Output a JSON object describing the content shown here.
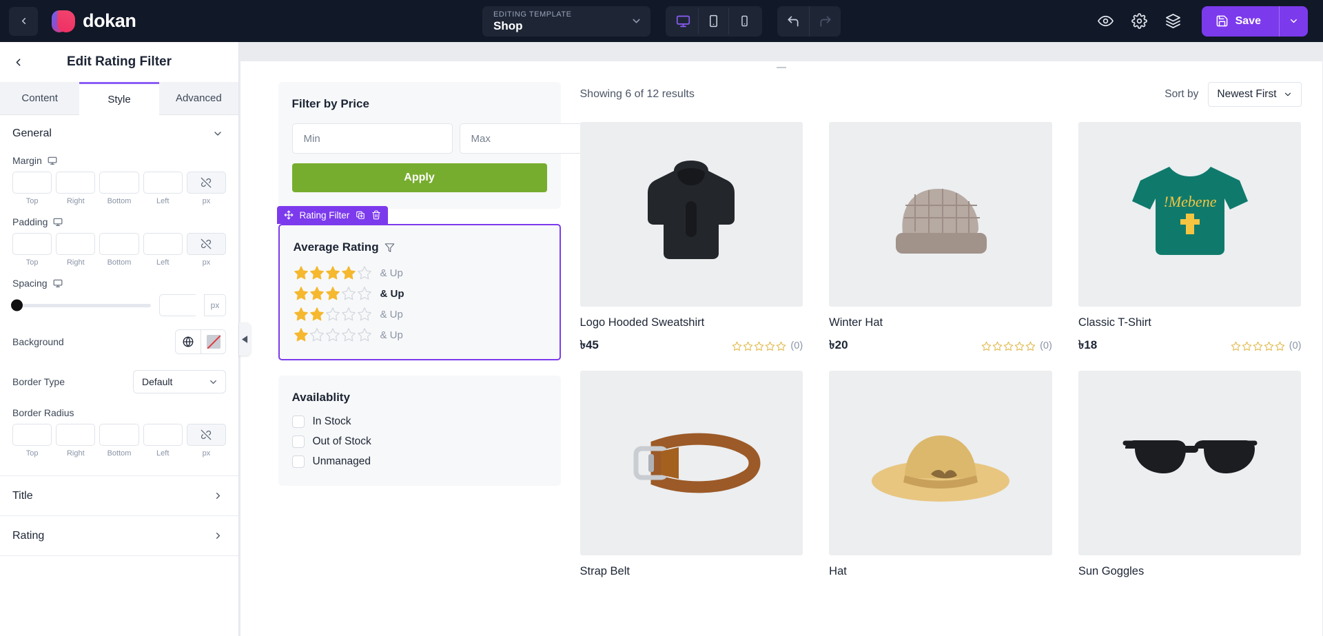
{
  "topbar": {
    "back_icon": "chevron-left-icon",
    "brand": "dokan",
    "template": {
      "label": "EDITING TEMPLATE",
      "value": "Shop",
      "caret_icon": "chevron-down-icon"
    },
    "devices": [
      {
        "name": "desktop",
        "icon": "desktop-icon",
        "active": true
      },
      {
        "name": "tablet",
        "icon": "tablet-icon",
        "active": false
      },
      {
        "name": "mobile",
        "icon": "mobile-icon",
        "active": false
      }
    ],
    "history": [
      {
        "name": "undo",
        "icon": "undo-icon",
        "enabled": true
      },
      {
        "name": "redo",
        "icon": "redo-icon",
        "enabled": false
      }
    ],
    "actions": [
      {
        "name": "preview",
        "icon": "eye-icon"
      },
      {
        "name": "settings",
        "icon": "gear-icon"
      },
      {
        "name": "layers",
        "icon": "layers-icon"
      }
    ],
    "save": {
      "label": "Save",
      "icon": "save-disk-icon",
      "caret_icon": "chevron-down-icon"
    },
    "accent": "#7c3aed",
    "background": "#111828"
  },
  "sidebar": {
    "back_icon": "chevron-left-icon",
    "title": "Edit Rating Filter",
    "tabs": [
      {
        "label": "Content",
        "active": false
      },
      {
        "label": "Style",
        "active": true
      },
      {
        "label": "Advanced",
        "active": false
      }
    ],
    "sections": {
      "general": {
        "title": "General",
        "caret_icon": "chevron-down-icon",
        "margin": {
          "label": "Margin",
          "responsive_icon": "desktop-icon",
          "values": [
            "",
            "",
            "",
            ""
          ],
          "captions": [
            "Top",
            "Right",
            "Bottom",
            "Left"
          ],
          "link_icon": "unlink-icon",
          "unit": "px"
        },
        "padding": {
          "label": "Padding",
          "responsive_icon": "desktop-icon",
          "values": [
            "",
            "",
            "",
            ""
          ],
          "captions": [
            "Top",
            "Right",
            "Bottom",
            "Left"
          ],
          "link_icon": "unlink-icon",
          "unit": "px"
        },
        "spacing": {
          "label": "Spacing",
          "responsive_icon": "desktop-icon",
          "value": "",
          "slider_percent": 0,
          "unit": "px"
        },
        "background": {
          "label": "Background",
          "globe_icon": "globe-icon",
          "swatch_icon": "no-color-swatch-icon"
        },
        "border_type": {
          "label": "Border Type",
          "value": "Default",
          "caret_icon": "chevron-down-icon"
        },
        "border_radius": {
          "label": "Border Radius",
          "values": [
            "",
            "",
            "",
            ""
          ],
          "captions": [
            "Top",
            "Right",
            "Bottom",
            "Left"
          ],
          "link_icon": "unlink-icon",
          "unit": "px"
        }
      },
      "collapsed": [
        {
          "title": "Title",
          "caret_icon": "chevron-right-icon"
        },
        {
          "title": "Rating",
          "caret_icon": "chevron-right-icon"
        }
      ]
    }
  },
  "canvas": {
    "collapse_handle_icon": "triangle-left-icon",
    "price_filter": {
      "title": "Filter by Price",
      "min_placeholder": "Min",
      "max_placeholder": "Max",
      "min_value": "",
      "max_value": "",
      "apply_label": "Apply",
      "apply_color": "#77ad2e"
    },
    "widget": {
      "badge_label": "Rating Filter",
      "badge_color": "#7c3aed",
      "badge_icons": [
        "move-icon",
        "duplicate-icon",
        "trash-icon"
      ],
      "title": "Average Rating",
      "title_icon": "funnel-filter-icon",
      "up_label": "& Up",
      "rows": [
        {
          "filled": 4,
          "total": 5,
          "selected": false
        },
        {
          "filled": 3,
          "total": 5,
          "selected": true
        },
        {
          "filled": 2,
          "total": 5,
          "selected": false
        },
        {
          "filled": 1,
          "total": 5,
          "selected": false
        }
      ],
      "star_color": "#f5b82e"
    },
    "availability": {
      "title": "Availablity",
      "options": [
        {
          "label": "In Stock",
          "checked": false
        },
        {
          "label": "Out of Stock",
          "checked": false
        },
        {
          "label": "Unmanaged",
          "checked": false
        }
      ]
    },
    "results": {
      "showing": "Showing 6 of 12 results",
      "sort_label": "Sort by",
      "sort_value": "Newest First",
      "sort_caret_icon": "chevron-down-icon"
    },
    "products": [
      {
        "name": "Logo Hooded Sweatshirt",
        "price": "৳45",
        "rating": 0,
        "reviews": "(0)",
        "thumb": "hoodie"
      },
      {
        "name": "Winter Hat",
        "price": "৳20",
        "rating": 0,
        "reviews": "(0)",
        "thumb": "beanie"
      },
      {
        "name": "Classic T-Shirt",
        "price": "৳18",
        "rating": 0,
        "reviews": "(0)",
        "thumb": "tshirt"
      },
      {
        "name": "Strap Belt",
        "price": "",
        "rating": 0,
        "reviews": "",
        "thumb": "belt"
      },
      {
        "name": "Hat",
        "price": "",
        "rating": 0,
        "reviews": "",
        "thumb": "sunhat"
      },
      {
        "name": "Sun Goggles",
        "price": "",
        "rating": 0,
        "reviews": "",
        "thumb": "sunglasses"
      }
    ]
  }
}
